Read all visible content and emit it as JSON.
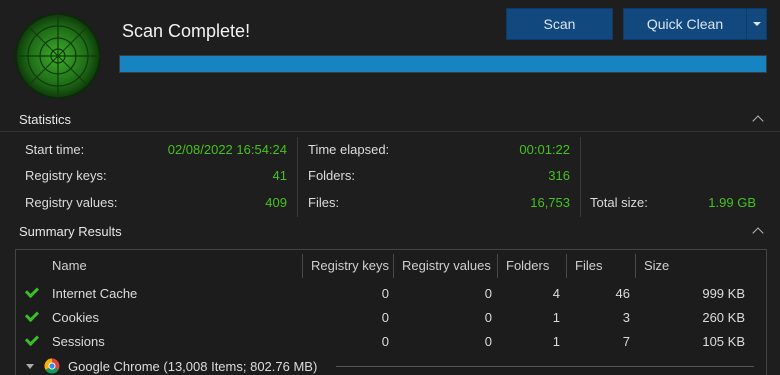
{
  "header": {
    "status_title": "Scan Complete!",
    "scan_button": "Scan",
    "quick_clean_button": "Quick Clean",
    "progress": 1.0,
    "accent_color": "#1683c2"
  },
  "statistics": {
    "heading": "Statistics",
    "start_time_label": "Start time:",
    "start_time_value": "02/08/2022 16:54:24",
    "registry_keys_label": "Registry keys:",
    "registry_keys_value": "41",
    "registry_values_label": "Registry values:",
    "registry_values_value": "409",
    "time_elapsed_label": "Time elapsed:",
    "time_elapsed_value": "00:01:22",
    "folders_label": "Folders:",
    "folders_value": "316",
    "files_label": "Files:",
    "files_value": "16,753",
    "total_size_label": "Total size:",
    "total_size_value": "1.99 GB",
    "value_color": "#46c21c"
  },
  "summary": {
    "heading": "Summary Results",
    "columns": [
      "Name",
      "Registry keys",
      "Registry values",
      "Folders",
      "Files",
      "Size"
    ],
    "rows": [
      {
        "name": "Internet Cache",
        "registry_keys": "0",
        "registry_values": "0",
        "folders": "4",
        "files": "46",
        "size": "999 KB"
      },
      {
        "name": "Cookies",
        "registry_keys": "0",
        "registry_values": "0",
        "folders": "1",
        "files": "3",
        "size": "260 KB"
      },
      {
        "name": "Sessions",
        "registry_keys": "0",
        "registry_values": "0",
        "folders": "1",
        "files": "7",
        "size": "105 KB"
      }
    ],
    "group": {
      "label": "Google Chrome (13,008 Items; 802.76 MB)",
      "icon": "chrome-icon"
    }
  }
}
